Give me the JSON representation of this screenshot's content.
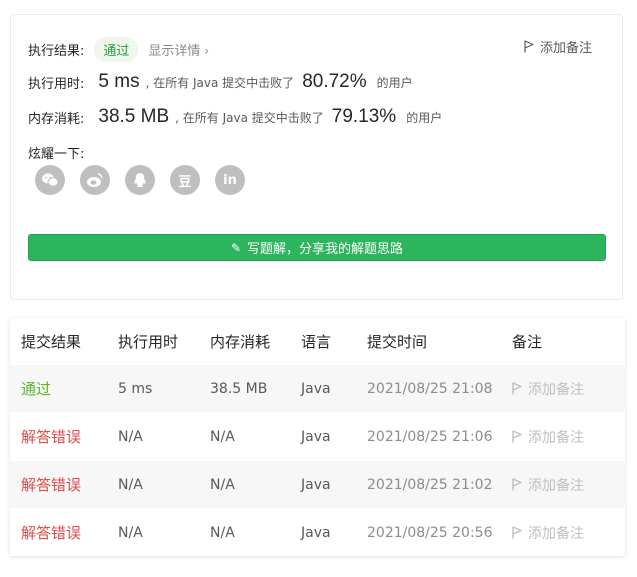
{
  "result": {
    "label": "执行结果:",
    "status": "通过",
    "details": "显示详情",
    "details_chevron": "›",
    "add_note": "添加备注"
  },
  "runtime": {
    "label": "执行用时:",
    "value": "5 ms",
    "mid": ", 在所有 Java 提交中击败了",
    "pct": "80.72%",
    "suffix": "的用户"
  },
  "memory": {
    "label": "内存消耗:",
    "value": "38.5 MB",
    "mid": ", 在所有 Java 提交中击败了",
    "pct": "79.13%",
    "suffix": "的用户"
  },
  "share": {
    "label": "炫耀一下:",
    "icons": [
      "wechat-icon",
      "weibo-icon",
      "qq-icon",
      "douban-icon",
      "linkedin-icon"
    ],
    "douban_glyph": "豆",
    "linkedin_glyph": "in"
  },
  "write_button": "写题解，分享我的解题思路",
  "table": {
    "headers": [
      "提交结果",
      "执行用时",
      "内存消耗",
      "语言",
      "提交时间",
      "备注"
    ],
    "rows": [
      {
        "status": "通过",
        "time": "5 ms",
        "memory": "38.5 MB",
        "lang": "Java",
        "submitted": "2021/08/25 21:08",
        "note": "添加备注"
      },
      {
        "status": "解答错误",
        "time": "N/A",
        "memory": "N/A",
        "lang": "Java",
        "submitted": "2021/08/25 21:06",
        "note": "添加备注"
      },
      {
        "status": "解答错误",
        "time": "N/A",
        "memory": "N/A",
        "lang": "Java",
        "submitted": "2021/08/25 21:02",
        "note": "添加备注"
      },
      {
        "status": "解答错误",
        "time": "N/A",
        "memory": "N/A",
        "lang": "Java",
        "submitted": "2021/08/25 20:56",
        "note": "添加备注"
      }
    ]
  },
  "colors": {
    "accepted": "#5ab726",
    "wrong": "#e24a4a",
    "primary_button": "#2db55d"
  }
}
